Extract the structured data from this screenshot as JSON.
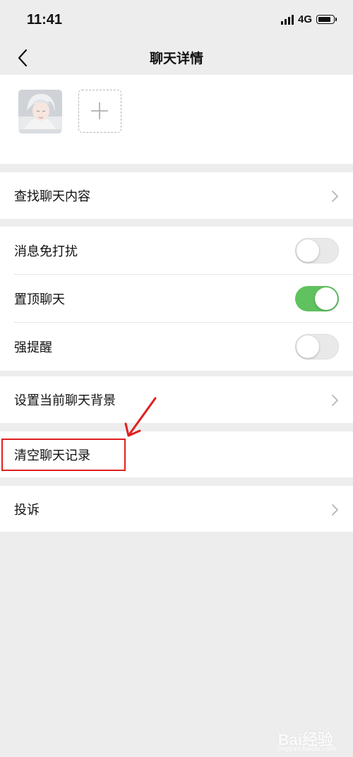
{
  "status_bar": {
    "time": "11:41",
    "network": "4G"
  },
  "nav": {
    "title": "聊天详情"
  },
  "settings": {
    "search_chat": "查找聊天内容",
    "mute": {
      "label": "消息免打扰",
      "on": false
    },
    "pin": {
      "label": "置顶聊天",
      "on": true
    },
    "alert": {
      "label": "强提醒",
      "on": false
    },
    "background": "设置当前聊天背景",
    "clear_history": "清空聊天记录",
    "report": "投诉"
  },
  "colors": {
    "toggle_on": "#5fc25f",
    "annotation": "#e02020",
    "background": "#ededed"
  },
  "watermark": {
    "text": "Bai经验",
    "sub": "jingyan.baidu.com"
  }
}
